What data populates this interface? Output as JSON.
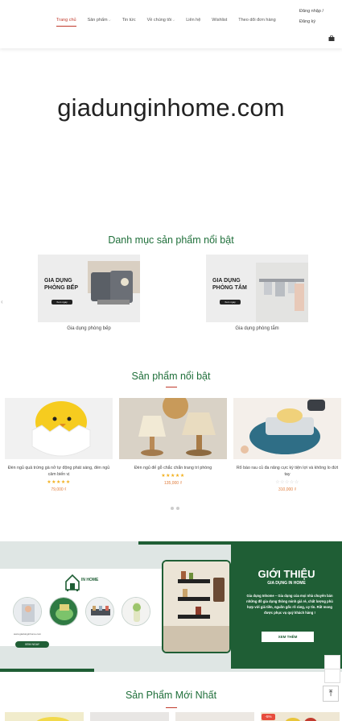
{
  "header": {
    "nav": [
      {
        "label": "Trang chủ",
        "dropdown": false,
        "active": true
      },
      {
        "label": "Sản phẩm",
        "dropdown": true,
        "active": false
      },
      {
        "label": "Tin tức",
        "dropdown": false,
        "active": false
      },
      {
        "label": "Về chúng tôi",
        "dropdown": true,
        "active": false
      },
      {
        "label": "Liên hệ",
        "dropdown": false,
        "active": false
      },
      {
        "label": "Wishlist",
        "dropdown": false,
        "active": false
      },
      {
        "label": "Theo dõi đơn hàng",
        "dropdown": false,
        "active": false
      }
    ],
    "login_label": "Đăng nhập /",
    "register_label": "Đăng ký",
    "cart_icon": "shopping-bag-icon"
  },
  "banner": {
    "logo_text": "giadunginhome.com"
  },
  "categories_section": {
    "title": "Danh mục sản phẩm nổi bật",
    "items": [
      {
        "tag_line1": "GIA DỤNG",
        "tag_line2": "PHÒNG BẾP",
        "button": "Xem ngay",
        "label": "Gia dụng phòng bếp"
      },
      {
        "tag_line1": "GIA DỤNG",
        "tag_line2": "PHÒNG TẮM",
        "button": "Xem ngay",
        "label": "Gia dụng phòng tắm"
      }
    ]
  },
  "featured_section": {
    "title": "Sản phẩm nổi bật",
    "products": [
      {
        "name": "Đèn ngủ quả trứng gà nở tự động phát sáng, đèn ngủ cảm biến vị",
        "stars": 5,
        "price": "79,000 ₫"
      },
      {
        "name": "Đèn ngủ đế gỗ chắc chắn trang trí phòng",
        "stars": 5,
        "price": "135,000 ₫"
      },
      {
        "name": "Rổ bào rau củ đa năng cực kỳ tiện lợi và không lo đứt tay",
        "stars": 0,
        "price": "310,000 ₫"
      }
    ]
  },
  "intro_section": {
    "brand_text": "IN HOME",
    "small_text": "www.giadunginhome.com",
    "pill_label": "XEM NGAY",
    "title": "GIỚI THIỆU",
    "subtitle": "GIA DỤNG IN HOME",
    "body": "Gia dụng Inhome – Gia dụng của mọi nhà chuyên bán những đồ gia dụng thông minh giá rẻ, chất lượng phù hợp với giá tiền, nguồn gốc rõ ràng, uy tín. Rất mong được phục vụ quý khách hàng !",
    "button_label": "XEM THÊM"
  },
  "new_section": {
    "title": "Sản Phẩm Mới Nhất",
    "sale_badge": "-5%"
  },
  "colors": {
    "brand_green": "#1f5e35",
    "accent_red": "#c0392b",
    "price_orange": "#e07b39",
    "star_yellow": "#f2b01e"
  }
}
